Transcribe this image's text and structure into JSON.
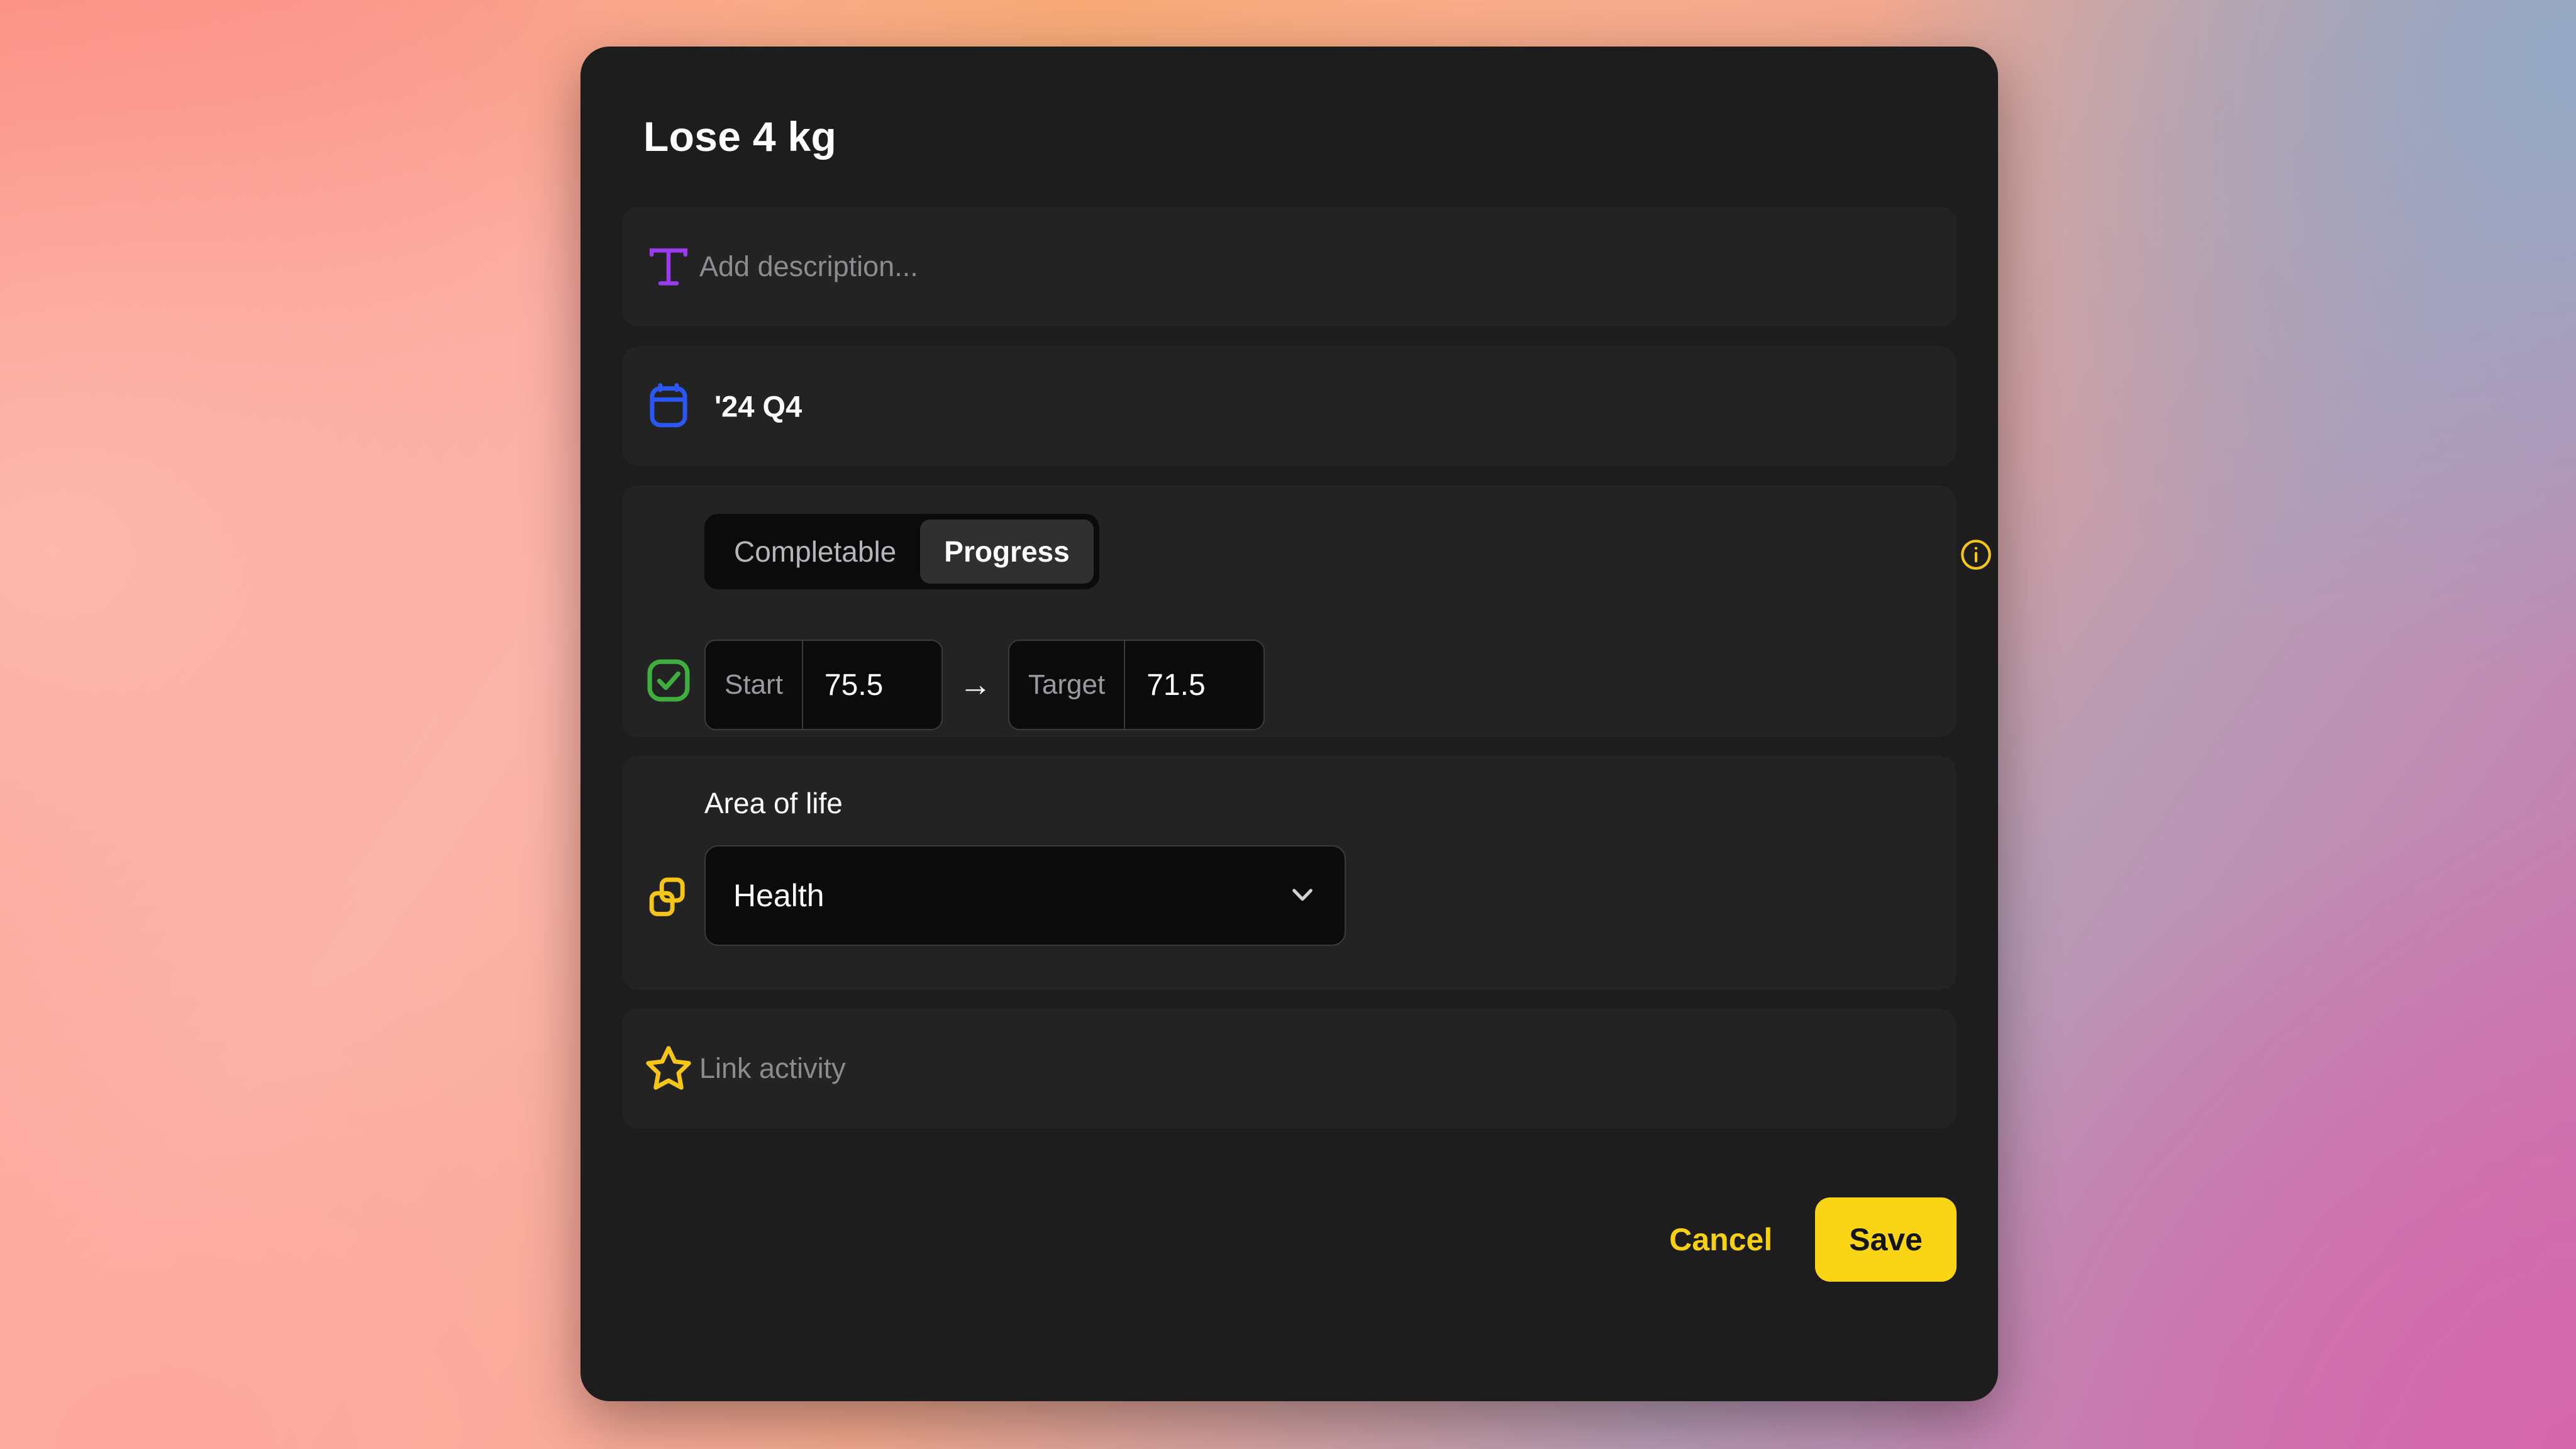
{
  "modal": {
    "title": "Lose 4 kg",
    "description": {
      "icon": "text-format-icon",
      "placeholder": "Add description...",
      "value": ""
    },
    "date": {
      "icon": "calendar-icon",
      "value": "'24 Q4"
    },
    "goal_type": {
      "icon": "checkbox-checked-icon",
      "info_icon": "info-circle-icon",
      "options": [
        {
          "label": "Completable",
          "active": false
        },
        {
          "label": "Progress",
          "active": true
        }
      ],
      "selected": "Progress",
      "start": {
        "label": "Start",
        "value": "75.5"
      },
      "arrow": "→",
      "target": {
        "label": "Target",
        "value": "71.5"
      }
    },
    "area_of_life": {
      "icon": "layers-icon",
      "label": "Area of life",
      "selected": "Health",
      "chevron_icon": "chevron-down-icon"
    },
    "link_activity": {
      "icon": "star-icon",
      "placeholder": "Link activity",
      "value": ""
    },
    "footer": {
      "cancel_label": "Cancel",
      "save_label": "Save"
    }
  },
  "colors": {
    "accent_yellow": "#fad516",
    "modal_bg": "#1d1d1d",
    "row_bg": "#232323",
    "icon_purple": "#9b3bf0",
    "icon_blue": "#2a57f5",
    "icon_green": "#3fae3f",
    "icon_yellow": "#f5c518"
  }
}
